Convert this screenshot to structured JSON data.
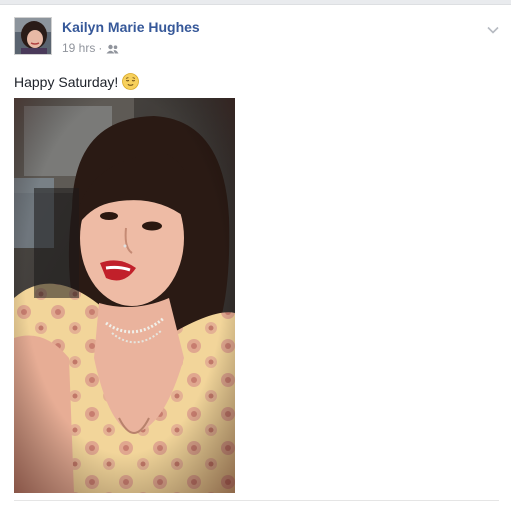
{
  "post": {
    "author_name": "Kailyn Marie Hughes",
    "timestamp": "19 hrs",
    "separator": "·",
    "audience_icon": "friends-icon",
    "menu_icon": "chevron-down-icon",
    "status_text": "Happy Saturday!",
    "status_emoji": "relieved-face-emoji"
  },
  "colors": {
    "author_link": "#365899",
    "meta_text": "#90949c",
    "body_text": "#1d2129",
    "page_background": "#e9ebee"
  }
}
